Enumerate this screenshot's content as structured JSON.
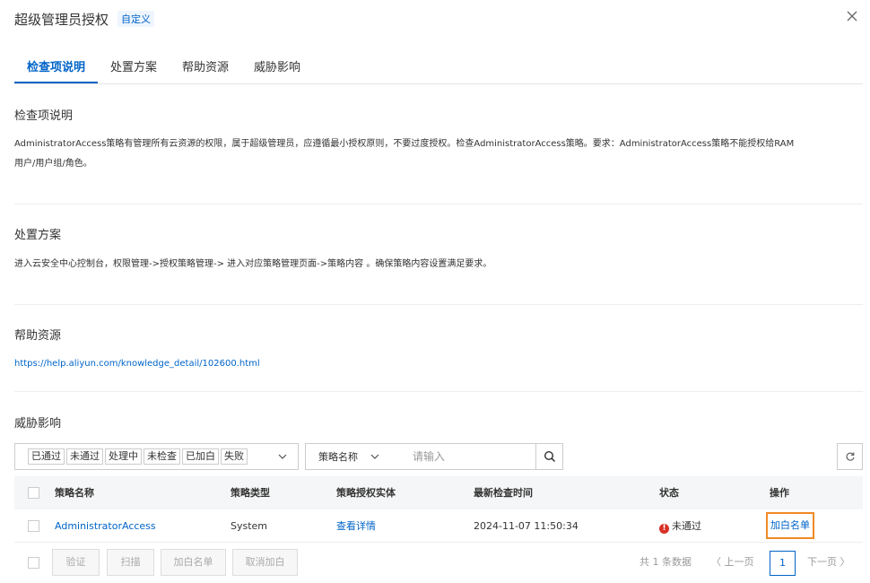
{
  "dialog": {
    "title": "超级管理员授权",
    "tag": "自定义"
  },
  "tabs": [
    {
      "label": "检查项说明"
    },
    {
      "label": "处置方案"
    },
    {
      "label": "帮助资源"
    },
    {
      "label": "威胁影响"
    }
  ],
  "sections": {
    "check": {
      "title": "检查项说明",
      "line1": "AdministratorAccess策略有管理所有云资源的权限，属于超级管理员，应遵循最小授权原则，不要过度授权。检查AdministratorAccess策略。要求：AdministratorAccess策略不能授权给RAM",
      "line2": "用户/用户组/角色。"
    },
    "solution": {
      "title": "处置方案",
      "text": "进入云安全中心控制台，权限管理->授权策略管理-> 进入对应策略管理页面->策略内容 。确保策略内容设置满足要求。"
    },
    "help": {
      "title": "帮助资源",
      "url": "https://help.aliyun.com/knowledge_detail/102600.html"
    },
    "threat": {
      "title": "威胁影响"
    }
  },
  "filters": {
    "status_buttons": [
      "已通过",
      "未通过",
      "处理中",
      "未检查",
      "已加白",
      "失败"
    ],
    "field_select": "策略名称",
    "search_placeholder": "请输入"
  },
  "table": {
    "headers": [
      "策略名称",
      "策略类型",
      "策略授权实体",
      "最新检查时间",
      "状态",
      "操作"
    ],
    "rows": [
      {
        "name": "AdministratorAccess",
        "type": "System",
        "entity": "查看详情",
        "time": "2024-11-07 11:50:34",
        "status": "未通过",
        "action": "加白名单"
      }
    ]
  },
  "footer": {
    "buttons": [
      "验证",
      "扫描",
      "加白名单",
      "取消加白"
    ],
    "total": "共 1 条数据",
    "prev": "上一页",
    "page": "1",
    "next": "下一页"
  },
  "colors": {
    "accent": "#0064c8",
    "fail": "#d93026",
    "highlight": "#f08a24"
  }
}
